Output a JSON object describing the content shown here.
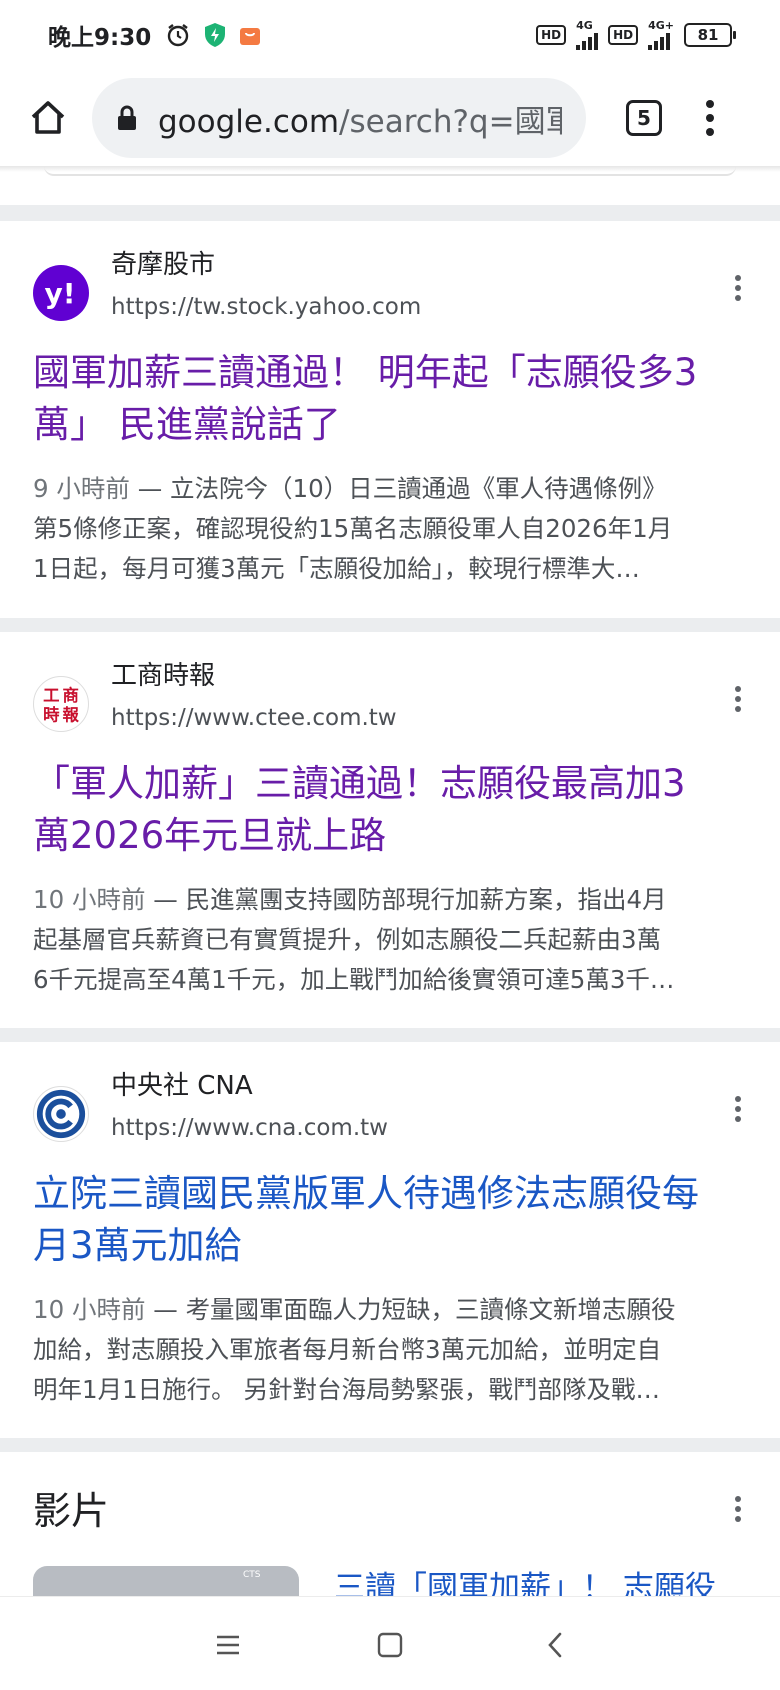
{
  "status_bar": {
    "time": "晚上9:30",
    "network_1": "4G",
    "network_2": "4G+",
    "hd_label": "HD",
    "battery": "81"
  },
  "browser": {
    "url_host": "google.com",
    "url_path": "/search?q=國軍",
    "tab_count": "5"
  },
  "results": [
    {
      "source_name": "奇摩股市",
      "source_url": "https://tw.stock.yahoo.com",
      "title_line1": "國軍加薪三讀通過！ 明年起「志願役多3",
      "title_line2": "萬」 民進黨說話了",
      "time": "9 小時前",
      "snippet_line1": "立法院今（10）日三讀通過《軍人待遇條例》",
      "snippet_line2": "第5條修正案，確認現役約15萬名志願役軍人自2026年1月",
      "snippet_line3": "1日起，每月可獲3萬元「志願役加給」，較現行標準大…"
    },
    {
      "source_name": "工商時報",
      "source_url": "https://www.ctee.com.tw",
      "favicon_text_1": "工",
      "favicon_text_2": "商",
      "favicon_text_3": "時",
      "favicon_text_4": "報",
      "title_line1": "「軍人加薪」三讀通過！志願役最高加3",
      "title_line2": "萬2026年元旦就上路",
      "time": "10 小時前",
      "snippet_line1": "民進黨團支持國防部現行加薪方案，指出4月",
      "snippet_line2": "起基層官兵薪資已有實質提升，例如志願役二兵起薪由3萬",
      "snippet_line3": "6千元提高至4萬1千元，加上戰鬥加給後實領可達5萬3千…"
    },
    {
      "source_name": "中央社 CNA",
      "source_url": "https://www.cna.com.tw",
      "title_line1": "立院三讀國民黨版軍人待遇修法志願役每",
      "title_line2": "月3萬元加給",
      "time": "10 小時前",
      "snippet_line1": "考量國軍面臨人力短缺，三讀條文新增志願役",
      "snippet_line2": "加給，對志願投入軍旅者每月新台幣3萬元加給，並明定自",
      "snippet_line3": "明年1月1日施行。 另針對台海局勢緊張，戰鬥部隊及戰…"
    }
  ],
  "videos": {
    "heading": "影片",
    "first_title": "三讀「國軍加薪」！ 志願役",
    "thumb_label": "CTS"
  },
  "separator": "—",
  "colors": {
    "visited_link": "#681da8",
    "link": "#1a57c5",
    "yahoo_purple": "#6001d2",
    "ctee_red": "#c8102e",
    "cna_blue": "#1b4f9c",
    "shield_green": "#1db374",
    "app_orange": "#f47a42"
  }
}
